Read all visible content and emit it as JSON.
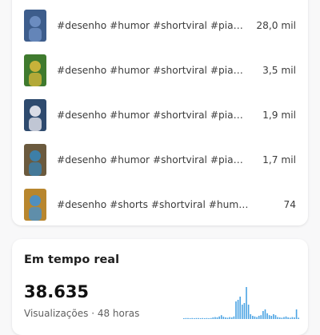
{
  "top_videos": [
    {
      "title": "#desenho #humor #shortviral #piada...",
      "views": "28,0 mil",
      "thumb_colors": [
        "#3d5d8c",
        "#6b8cc0"
      ]
    },
    {
      "title": "#desenho #humor #shortviral #piadas...",
      "views": "3,5 mil",
      "thumb_colors": [
        "#3f7a2e",
        "#c8b23a"
      ]
    },
    {
      "title": "#desenho #humor #shortviral #piadas...",
      "views": "1,9 mil",
      "thumb_colors": [
        "#2e4a6e",
        "#d9dce6"
      ]
    },
    {
      "title": "#desenho #humor #shortviral #piadas...",
      "views": "1,7 mil",
      "thumb_colors": [
        "#6b5a3e",
        "#3d7fa8"
      ]
    },
    {
      "title": "#desenho #shorts #shortviral #humor #pia...",
      "views": "74",
      "thumb_colors": [
        "#b8862e",
        "#4f8fbf"
      ]
    }
  ],
  "realtime": {
    "title": "Em tempo real",
    "value": "38.635",
    "caption": "Visualizações · 48 horas",
    "bar_color": "#4ba3e3",
    "bars": [
      0.02,
      0.03,
      0.03,
      0.02,
      0.03,
      0.02,
      0.03,
      0.03,
      0.02,
      0.03,
      0.02,
      0.03,
      0.02,
      0.03,
      0.05,
      0.06,
      0.05,
      0.08,
      0.12,
      0.07,
      0.05,
      0.04,
      0.06,
      0.05,
      0.08,
      0.55,
      0.6,
      0.7,
      0.45,
      0.5,
      1.0,
      0.45,
      0.15,
      0.1,
      0.08,
      0.06,
      0.1,
      0.12,
      0.25,
      0.3,
      0.18,
      0.12,
      0.1,
      0.15,
      0.12,
      0.06,
      0.05,
      0.04,
      0.06,
      0.08,
      0.05,
      0.04,
      0.06,
      0.05,
      0.3,
      0.04
    ]
  }
}
